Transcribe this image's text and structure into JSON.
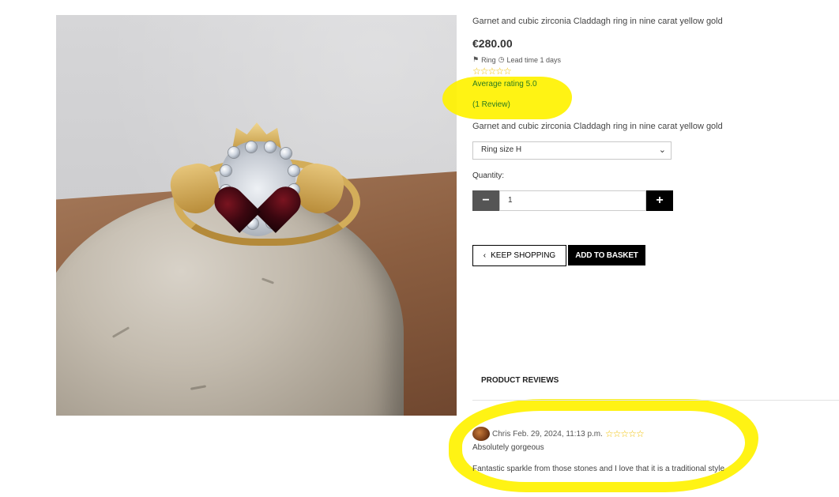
{
  "product": {
    "title": "Garnet and cubic zirconia Claddagh ring in nine carat yellow gold",
    "price": "€280.00",
    "category": "Ring",
    "lead_time": "Lead time 1 days",
    "rating_stars": "☆☆☆☆☆",
    "average_rating": "Average rating 5.0",
    "review_count": "(1 Review)",
    "description": "Garnet and cubic zirconia Claddagh ring in nine carat yellow gold"
  },
  "options": {
    "ring_size_selected": "Ring size H"
  },
  "quantity": {
    "label": "Quantity:",
    "value": "1",
    "minus": "−",
    "plus": "+"
  },
  "actions": {
    "keep_shopping": "KEEP SHOPPING",
    "keep_shopping_icon": "‹",
    "add_to_basket": "ADD TO BASKET"
  },
  "reviews": {
    "heading": "PRODUCT REVIEWS",
    "items": [
      {
        "author_date": "Chris Feb. 29, 2024, 11:13 p.m.",
        "stars": "☆☆☆☆☆",
        "title": "Absolutely gorgeous",
        "body": "Fantastic sparkle from those stones and I love that it is a traditional style"
      }
    ]
  },
  "icons": {
    "tag": "tag-icon",
    "clock": "clock-icon",
    "chevron_left": "chevron-left-icon",
    "chevron_down": "chevron-down-icon"
  },
  "colors": {
    "highlight": "#fff200",
    "rating_text": "#2a7a20",
    "star": "#f0c000",
    "button_dark": "#000000"
  }
}
